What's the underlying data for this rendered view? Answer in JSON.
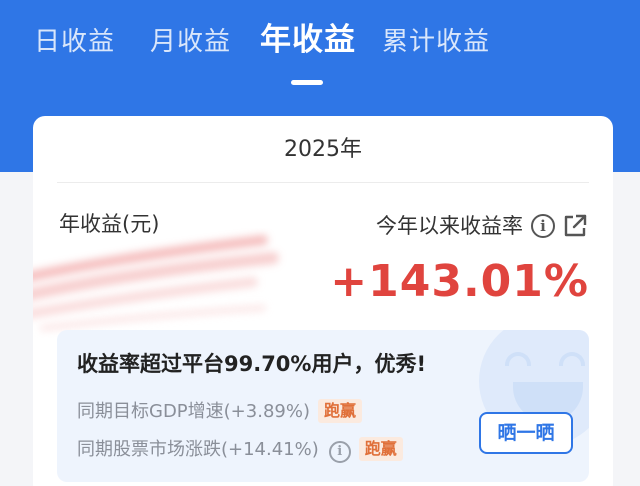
{
  "tabs": [
    {
      "label": "日收益",
      "active": false
    },
    {
      "label": "月收益",
      "active": false
    },
    {
      "label": "年收益",
      "active": true
    },
    {
      "label": "累计收益",
      "active": false
    }
  ],
  "card": {
    "year": "2025年",
    "income_label": "年收益(元)",
    "rate_label": "今年以来收益率",
    "rate_value": "+143.01%",
    "info_icon": "info-circle-icon",
    "share_icon": "external-share-icon"
  },
  "ranking": {
    "title": "收益率超过平台99.70%用户，优秀!",
    "rows": [
      {
        "label": "同期目标GDP增速(+3.89%)",
        "badge": "跑赢"
      },
      {
        "label": "同期股票市场涨跌(+14.41%)",
        "badge": "跑赢",
        "info_icon": "info-circle-icon"
      }
    ],
    "share_button": "晒一晒"
  },
  "colors": {
    "header_blue": "#2f76e6",
    "gain_red": "#e0443e",
    "badge_orange": "#e0703a",
    "badge_bg": "#fbeadf",
    "panel_bg": "#eef4fd"
  }
}
